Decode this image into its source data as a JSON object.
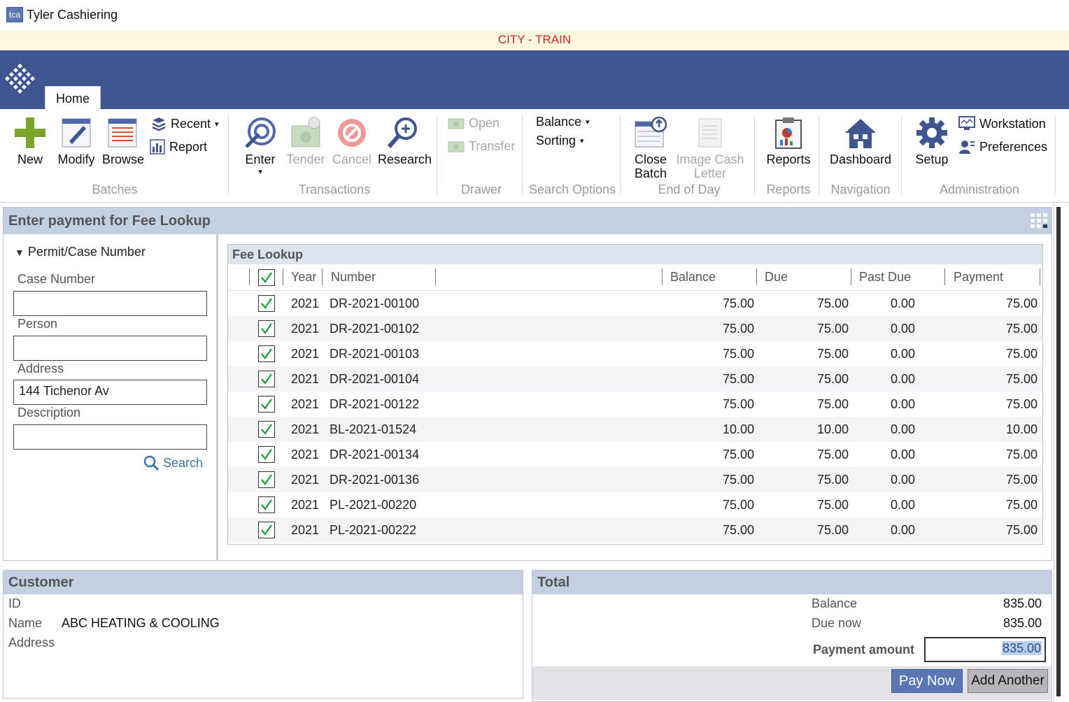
{
  "app": {
    "icon_text": "tca",
    "title": "Tyler Cashiering"
  },
  "environment": "CITY - TRAIN",
  "tabs": {
    "home": "Home"
  },
  "ribbon": {
    "batches": {
      "new": "New",
      "modify": "Modify",
      "browse": "Browse",
      "recent": "Recent",
      "report": "Report",
      "group": "Batches"
    },
    "transactions": {
      "enter": "Enter",
      "tender": "Tender",
      "cancel": "Cancel",
      "research": "Research",
      "group": "Transactions"
    },
    "drawer": {
      "open": "Open",
      "transfer": "Transfer",
      "group": "Drawer"
    },
    "search_options": {
      "balance": "Balance",
      "sorting": "Sorting",
      "group": "Search Options"
    },
    "end_of_day": {
      "close_line1": "Close",
      "close_line2": "Batch",
      "image_line1": "Image Cash",
      "image_line2": "Letter",
      "group": "End of Day"
    },
    "reports": {
      "reports": "Reports",
      "group": "Reports"
    },
    "navigation": {
      "dashboard": "Dashboard",
      "group": "Navigation"
    },
    "administration": {
      "setup": "Setup",
      "workstation": "Workstation",
      "preferences": "Preferences",
      "group": "Administration"
    }
  },
  "main": {
    "title": "Enter payment for Fee Lookup",
    "left": {
      "section": "Permit/Case Number",
      "case_number_label": "Case Number",
      "case_number_value": "",
      "person_label": "Person",
      "person_value": "",
      "address_label": "Address",
      "address_value": "144 Tichenor Av",
      "description_label": "Description",
      "description_value": "",
      "search": "Search"
    },
    "fee_lookup": {
      "title": "Fee Lookup",
      "columns": {
        "year": "Year",
        "number": "Number",
        "balance": "Balance",
        "due": "Due",
        "past_due": "Past Due",
        "payment": "Payment"
      },
      "rows": [
        {
          "year": "2021",
          "number": "DR-2021-00100",
          "balance": "75.00",
          "due": "75.00",
          "past_due": "0.00",
          "payment": "75.00"
        },
        {
          "year": "2021",
          "number": "DR-2021-00102",
          "balance": "75.00",
          "due": "75.00",
          "past_due": "0.00",
          "payment": "75.00"
        },
        {
          "year": "2021",
          "number": "DR-2021-00103",
          "balance": "75.00",
          "due": "75.00",
          "past_due": "0.00",
          "payment": "75.00"
        },
        {
          "year": "2021",
          "number": "DR-2021-00104",
          "balance": "75.00",
          "due": "75.00",
          "past_due": "0.00",
          "payment": "75.00"
        },
        {
          "year": "2021",
          "number": "DR-2021-00122",
          "balance": "75.00",
          "due": "75.00",
          "past_due": "0.00",
          "payment": "75.00"
        },
        {
          "year": "2021",
          "number": "BL-2021-01524",
          "balance": "10.00",
          "due": "10.00",
          "past_due": "0.00",
          "payment": "10.00"
        },
        {
          "year": "2021",
          "number": "DR-2021-00134",
          "balance": "75.00",
          "due": "75.00",
          "past_due": "0.00",
          "payment": "75.00"
        },
        {
          "year": "2021",
          "number": "DR-2021-00136",
          "balance": "75.00",
          "due": "75.00",
          "past_due": "0.00",
          "payment": "75.00"
        },
        {
          "year": "2021",
          "number": "PL-2021-00220",
          "balance": "75.00",
          "due": "75.00",
          "past_due": "0.00",
          "payment": "75.00"
        },
        {
          "year": "2021",
          "number": "PL-2021-00222",
          "balance": "75.00",
          "due": "75.00",
          "past_due": "0.00",
          "payment": "75.00"
        }
      ]
    }
  },
  "customer": {
    "title": "Customer",
    "id_label": "ID",
    "id_value": "",
    "name_label": "Name",
    "name_value": "ABC HEATING & COOLING",
    "address_label": "Address",
    "address_value": ""
  },
  "total": {
    "title": "Total",
    "balance_label": "Balance",
    "balance_value": "835.00",
    "due_now_label": "Due now",
    "due_now_value": "835.00",
    "payment_amount_label": "Payment amount",
    "payment_amount_value": "835.00",
    "pay_now": "Pay Now",
    "add_another": "Add Another"
  },
  "colors": {
    "brand_blue": "#3e5590",
    "env_text": "#c8282e",
    "panel_header": "#c3d0e2",
    "check_green": "#1a9c3a"
  },
  "icons": [
    "app-icon",
    "logo-icon",
    "new-icon",
    "modify-icon",
    "browse-icon",
    "recent-icon",
    "report-icon",
    "enter-icon",
    "tender-icon",
    "cancel-icon",
    "research-icon",
    "open-drawer-icon",
    "transfer-icon",
    "close-batch-icon",
    "image-cash-letter-icon",
    "reports-icon",
    "dashboard-icon",
    "setup-icon",
    "workstation-icon",
    "preferences-icon",
    "search-icon",
    "grid-icon",
    "checkbox-check-icon"
  ]
}
